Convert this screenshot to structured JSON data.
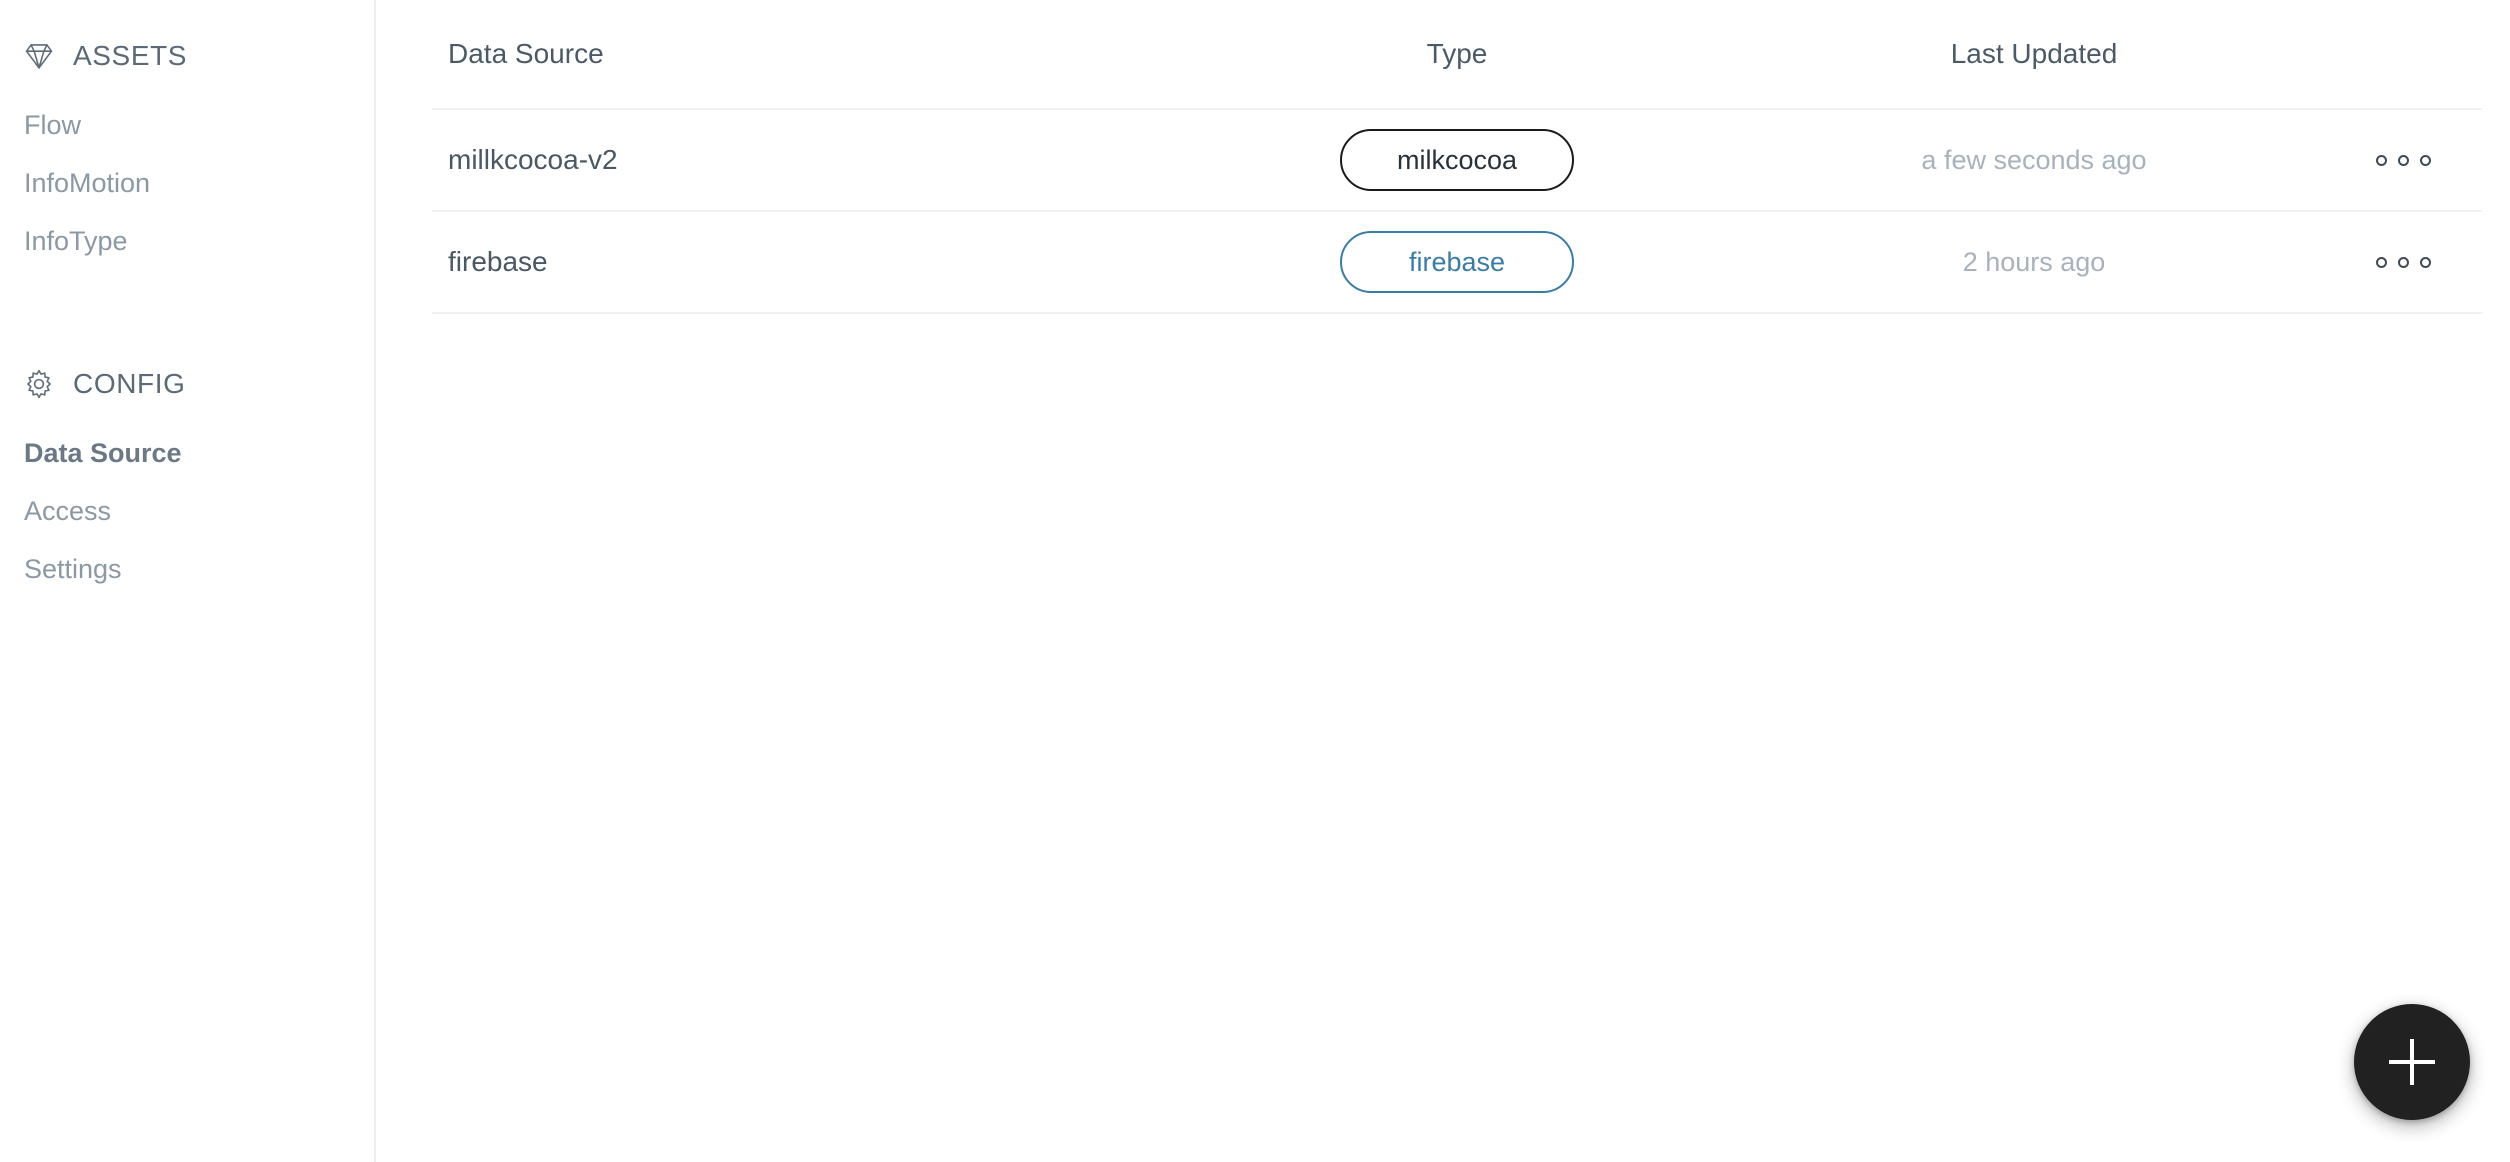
{
  "sidebar": {
    "sections": [
      {
        "icon": "diamond-icon",
        "title": "ASSETS",
        "items": [
          {
            "label": "Flow",
            "active": false
          },
          {
            "label": "InfoMotion",
            "active": false
          },
          {
            "label": "InfoType",
            "active": false
          }
        ]
      },
      {
        "icon": "gear-icon",
        "title": "CONFIG",
        "items": [
          {
            "label": "Data Source",
            "active": true
          },
          {
            "label": "Access",
            "active": false
          },
          {
            "label": "Settings",
            "active": false
          }
        ]
      }
    ]
  },
  "table": {
    "columns": {
      "name": "Data Source",
      "type": "Type",
      "updated": "Last Updated"
    },
    "rows": [
      {
        "name": "millkcocoa-v2",
        "type": "milkcocoa",
        "type_color": "#1a1a1a",
        "updated": "a few seconds ago"
      },
      {
        "name": "firebase",
        "type": "firebase",
        "type_color": "#3a7ca8",
        "updated": "2 hours ago"
      }
    ],
    "row_menu_icon": "more-options-icon"
  },
  "fab": {
    "icon": "plus-icon",
    "label": "+"
  },
  "colors": {
    "accent_blue": "#3a7ca8",
    "text_primary": "#4a5764",
    "text_muted": "#a8b2bc",
    "divider": "#eef0f1",
    "fab_background": "#212121"
  }
}
